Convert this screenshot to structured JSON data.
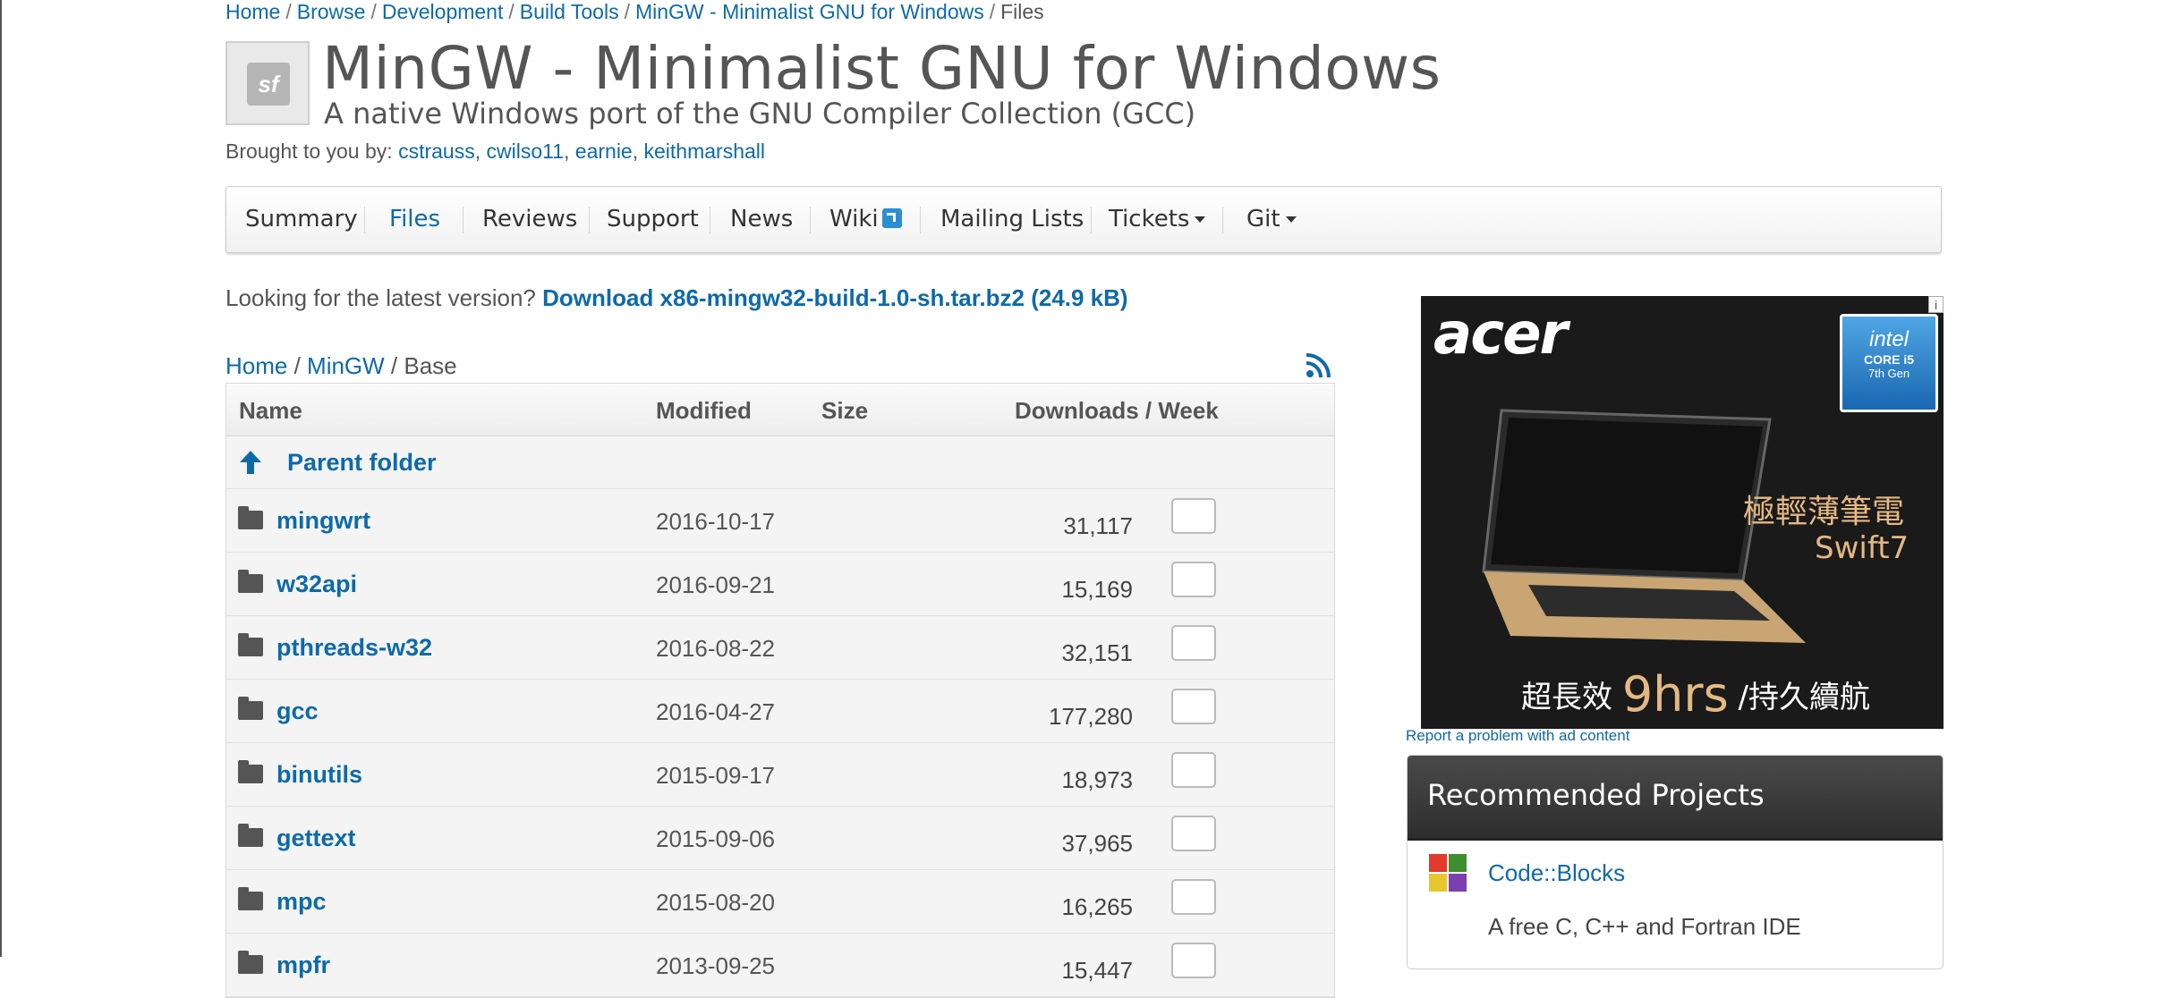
{
  "breadcrumb": [
    "Home",
    "Browse",
    "Development",
    "Build Tools",
    "MinGW - Minimalist GNU for Windows",
    "Files"
  ],
  "logo_text": "sf",
  "project": {
    "title": "MinGW - Minimalist GNU for Windows",
    "subtitle": "A native Windows port of the GNU Compiler Collection (GCC)",
    "brought_label": "Brought to you by:",
    "authors": [
      "cstrauss",
      "cwilso11",
      "earnie",
      "keithmarshall"
    ]
  },
  "nav": [
    "Summary",
    "Files",
    "Reviews",
    "Support",
    "News",
    "Wiki",
    "Mailing Lists",
    "Tickets",
    "Git"
  ],
  "latest": {
    "label": "Looking for the latest version?",
    "link": "Download x86-mingw32-build-1.0-sh.tar.bz2 (24.9 kB)"
  },
  "path": {
    "home": "Home",
    "mingw": "MinGW",
    "current": "Base"
  },
  "table": {
    "headers": {
      "name": "Name",
      "modified": "Modified",
      "size": "Size",
      "downloads": "Downloads / Week"
    },
    "parent": "Parent folder",
    "rows": [
      {
        "name": "mingwrt",
        "date": "2016-10-17",
        "count": "31,117"
      },
      {
        "name": "w32api",
        "date": "2016-09-21",
        "count": "15,169"
      },
      {
        "name": "pthreads-w32",
        "date": "2016-08-22",
        "count": "32,151"
      },
      {
        "name": "gcc",
        "date": "2016-04-27",
        "count": "177,280"
      },
      {
        "name": "binutils",
        "date": "2015-09-17",
        "count": "18,973"
      },
      {
        "name": "gettext",
        "date": "2015-09-06",
        "count": "37,965"
      },
      {
        "name": "mpc",
        "date": "2015-08-20",
        "count": "16,265"
      },
      {
        "name": "mpfr",
        "date": "2013-09-25",
        "count": "15,447"
      }
    ]
  },
  "ad": {
    "brand": "acer",
    "badge": {
      "line1": "intel",
      "line2": "CORE i5",
      "line3": "7th Gen"
    },
    "tagline1": "極輕薄筆電",
    "tagline2": "Swift7",
    "bottom_a": "超長效",
    "bottom_big": "9hrs",
    "bottom_b": "/持久續航",
    "report": "Report a problem with ad content"
  },
  "recommended": {
    "heading": "Recommended Projects",
    "item": {
      "name": "Code::Blocks",
      "desc": "A free C, C++ and Fortran IDE"
    }
  },
  "colors": {
    "link": "#0d6aa8",
    "ad_gold": "#e5b883"
  },
  "icons": [
    "rss-icon",
    "folder-icon",
    "up-arrow-icon",
    "external-link-icon",
    "caret-down-icon",
    "codeblocks-icon"
  ]
}
